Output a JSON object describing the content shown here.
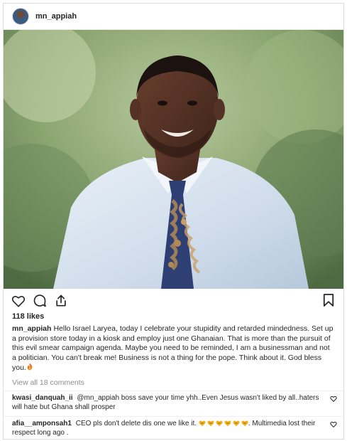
{
  "header": {
    "username": "mn_appiah"
  },
  "photo": {
    "description_icon": "portrait-photo"
  },
  "actions": {
    "icons": [
      "heart-icon",
      "comment-icon",
      "share-icon",
      "bookmark-icon"
    ]
  },
  "likes": {
    "text": "118 likes"
  },
  "caption": {
    "username": "mn_appiah",
    "text": "Hello Israel Laryea, today I celebrate your stupidity and retarded mindedness. Set up a provision store today in a kiosk and employ just one Ghanaian. That is more than the pursuit of this evil smear campaign agenda. Maybe you need to be reminded, I am a businessman and not a politician. You can't break me! Business is not a thing for the pope. Think about it. God bless you.",
    "emoji": "fire"
  },
  "view_all": {
    "text": "View all 18 comments"
  },
  "comments": [
    {
      "username": "kwasi_danquah_ii",
      "text": "@mn_appiah boss save your time yhh..Even Jesus wasn't liked by all..haters will hate but Ghana shall prosper"
    },
    {
      "username": "afia__amponsah1",
      "text_before": "CEO pls don't delete dis one we like it.",
      "emoji_count": 6,
      "text_after": ". Multimedia lost their respect long ago ."
    }
  ],
  "colors": {
    "text": "#262626",
    "muted": "#8e8e8e",
    "border": "#dbdbdb",
    "shirt": "#d7e3f0",
    "tie": "#2e3f73",
    "tie_pattern": "#b08a55",
    "emoji_heart": "#f2b01e"
  }
}
